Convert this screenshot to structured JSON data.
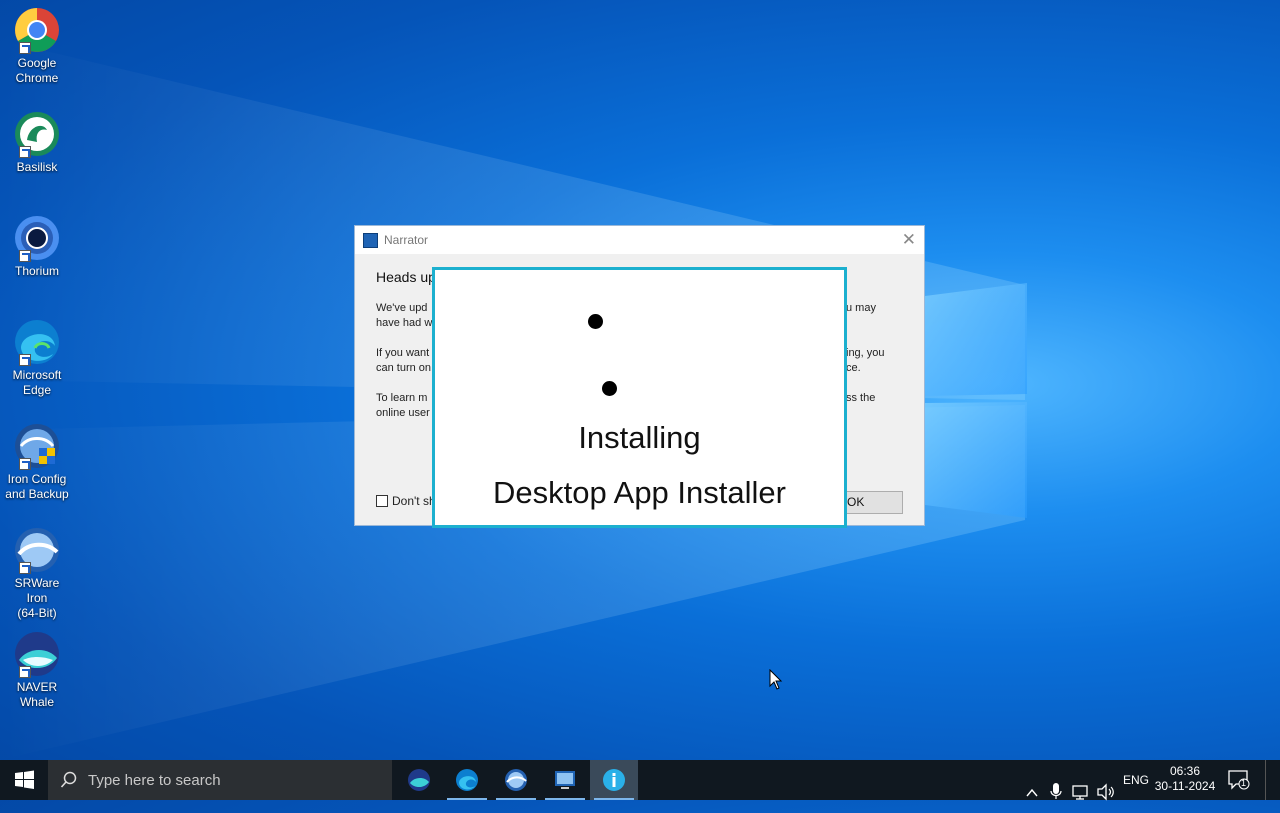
{
  "desktop": {
    "icons": [
      {
        "label": "Google\nChrome",
        "line1": "Google",
        "line2": "Chrome"
      },
      {
        "label": "Basilisk",
        "line1": "Basilisk",
        "line2": ""
      },
      {
        "label": "Thorium",
        "line1": "Thorium",
        "line2": ""
      },
      {
        "label": "Microsoft Edge",
        "line1": "Microsoft",
        "line2": "Edge"
      },
      {
        "label": "Iron Config and Backup",
        "line1": "Iron Config",
        "line2": "and Backup"
      },
      {
        "label": "SRWare Iron (64-Bit)",
        "line1": "SRWare Iron",
        "line2": "(64-Bit)"
      },
      {
        "label": "NAVER Whale",
        "line1": "NAVER",
        "line2": "Whale"
      }
    ]
  },
  "dialog": {
    "title": "Narrator",
    "close_glyph": "✕",
    "heading": "Heads up",
    "para1_left": "We've upd",
    "para1_left2": "have had w",
    "para1_right": "u may",
    "para2_left": "If you want",
    "para2_left2": "can turn on",
    "para2_right": "ing, you",
    "para2_right2": "ce.",
    "para3_left": "To learn m",
    "para3_left2": "online user",
    "para3_right": "ss the",
    "checkbox_label": "Don't sh",
    "ok_label": "OK"
  },
  "installer": {
    "line1": "Installing",
    "line2": "Desktop App Installer"
  },
  "taskbar": {
    "search_placeholder": "Type here to search",
    "tray": {
      "language": "ENG",
      "time": "06:36",
      "date": "30-11-2024",
      "notification_count": "1"
    }
  },
  "colors": {
    "accent": "#1cb0cf",
    "taskbar": "#101820",
    "desktop": "#0a6fd8"
  }
}
